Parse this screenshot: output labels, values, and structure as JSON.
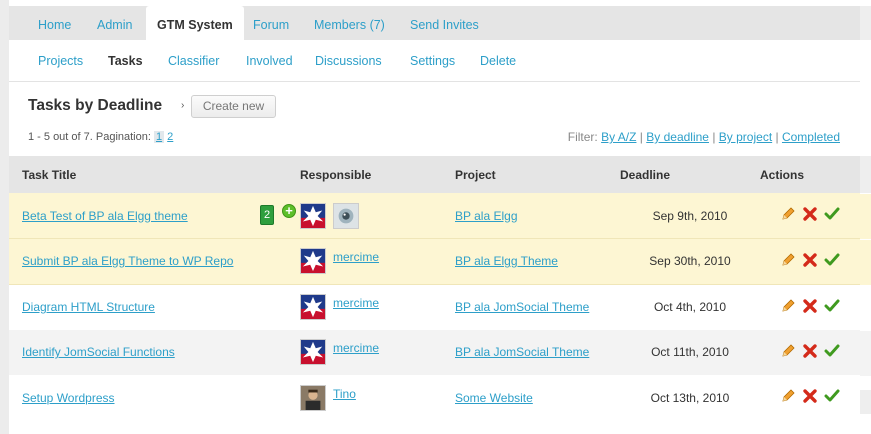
{
  "primary_nav": {
    "items": [
      {
        "label": "Home",
        "active": false
      },
      {
        "label": "Admin",
        "active": false
      },
      {
        "label": "GTM System",
        "active": true
      },
      {
        "label": "Forum",
        "active": false
      },
      {
        "label": "Members (7)",
        "active": false
      },
      {
        "label": "Send Invites",
        "active": false
      }
    ]
  },
  "sub_nav": {
    "items": [
      {
        "label": "Projects",
        "active": false
      },
      {
        "label": "Tasks",
        "active": true
      },
      {
        "label": "Classifier",
        "active": false
      },
      {
        "label": "Involved",
        "active": false
      },
      {
        "label": "Discussions",
        "active": false
      },
      {
        "label": "Settings",
        "active": false
      },
      {
        "label": "Delete",
        "active": false
      }
    ]
  },
  "header": {
    "title": "Tasks by Deadline",
    "arrow": "›",
    "create_label": "Create new"
  },
  "pagination": {
    "summary": "1 - 5 out of 7. Pagination:",
    "pages": [
      "1",
      "2"
    ]
  },
  "filter": {
    "label": "Filter:",
    "links": [
      "By A/Z",
      "By deadline",
      "By project",
      "Completed"
    ],
    "separator": "|"
  },
  "table": {
    "columns": {
      "title": "Task Title",
      "responsible": "Responsible",
      "project": "Project",
      "deadline": "Deadline",
      "actions": "Actions"
    },
    "rows": [
      {
        "title": "Beta Test of BP ala Elgg theme",
        "responsible": "",
        "project": "BP ala Elgg",
        "deadline": "Sep 9th, 2010",
        "badge": "2",
        "style": "yellow"
      },
      {
        "title": "Submit BP ala Elgg Theme to WP Repo",
        "responsible": "mercime",
        "project": "BP ala Elgg Theme",
        "deadline": "Sep 30th, 2010",
        "style": "yellow"
      },
      {
        "title": "Diagram HTML Structure",
        "responsible": "mercime",
        "project": "BP ala JomSocial Theme",
        "deadline": "Oct 4th, 2010",
        "style": "white"
      },
      {
        "title": "Identify JomSocial Functions",
        "responsible": "mercime",
        "project": "BP ala JomSocial Theme",
        "deadline": "Oct 11th, 2010",
        "style": "grey"
      },
      {
        "title": "Setup Wordpress",
        "responsible": "Tino",
        "project": "Some Website",
        "deadline": "Oct 13th, 2010",
        "style": "white"
      }
    ]
  },
  "icons": {
    "edit": "pencil-icon",
    "delete": "red-x-icon",
    "complete": "green-check-icon",
    "add": "green-plus-icon"
  },
  "colors": {
    "link": "#2d9fc9",
    "highlight_row": "#fdf6d3",
    "header_bg": "#e5e5e5"
  }
}
